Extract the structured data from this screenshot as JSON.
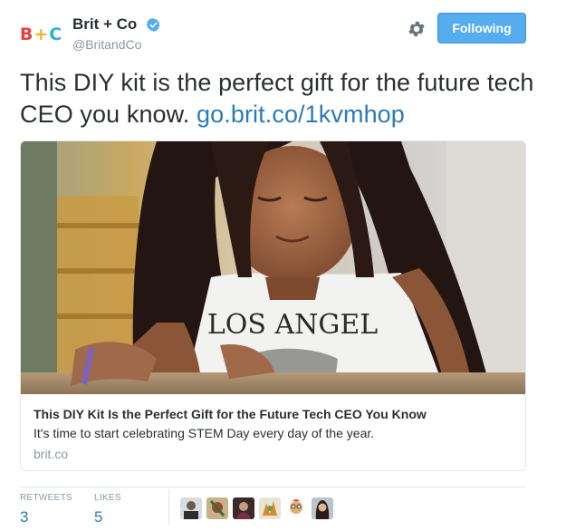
{
  "header": {
    "avatar_icon": "brit-co-logo",
    "logo": {
      "b": "B",
      "plus": "+",
      "c": "C"
    },
    "display_name": "Brit + Co",
    "verified_icon": "verified-badge-icon",
    "handle": "@BritandCo",
    "settings_icon": "gear-icon",
    "follow_button_label": "Following"
  },
  "tweet": {
    "text": "This DIY kit is the perfect gift for the future tech CEO you know.",
    "link": "go.brit.co/1kvmhop"
  },
  "card": {
    "image_description": "girl-with-long-dark-hair-wearing-los-angeles-tank-top",
    "image_shirt_text": "LOS ANGEL",
    "title": "This DIY Kit Is the Perfect Gift for the Future Tech CEO You Know",
    "description": "It's time to start celebrating STEM Day every day of the year.",
    "domain": "brit.co"
  },
  "stats": {
    "retweets_label": "RETWEETS",
    "retweets_count": "3",
    "likes_label": "LIKES",
    "likes_count": "5"
  },
  "likers": [
    "liker-avatar-1",
    "liker-avatar-2",
    "liker-avatar-3",
    "liker-avatar-4",
    "liker-avatar-5",
    "liker-avatar-6"
  ],
  "colors": {
    "link_blue": "#2b7bb9",
    "button_blue": "#55acee",
    "muted_gray": "#8899a6",
    "logo_red": "#e8413d",
    "logo_yellow": "#f6b21b",
    "logo_blue": "#29b3d6"
  }
}
